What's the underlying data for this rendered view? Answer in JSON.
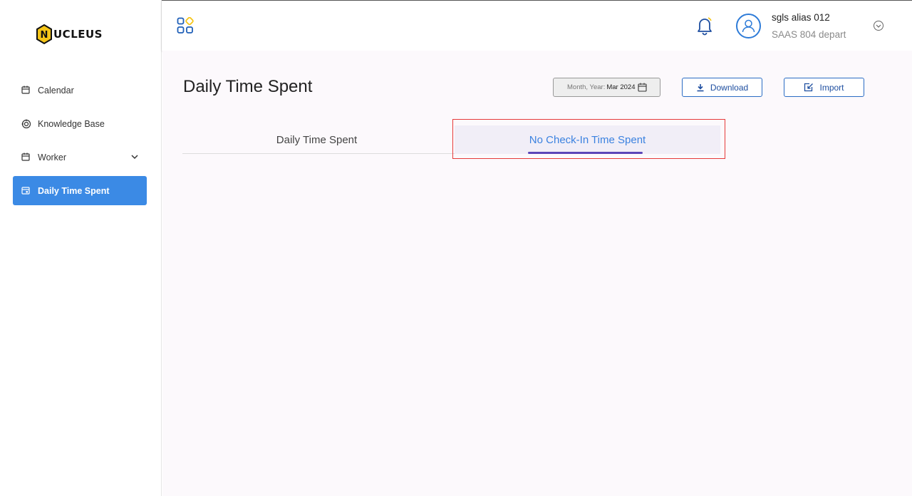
{
  "sidebar": {
    "logo_text": "UCLEUS",
    "logo_letter": "N",
    "items": [
      {
        "label": "Calendar",
        "icon": "calendar-icon"
      },
      {
        "label": "Knowledge Base",
        "icon": "knowledge-base-icon"
      },
      {
        "label": "Worker",
        "icon": "calendar-icon"
      },
      {
        "label": "Daily Time Spent",
        "icon": "calendar-icon"
      }
    ]
  },
  "header": {
    "user_name": "sgls alias 012",
    "user_dept": "SAAS 804 depart"
  },
  "main": {
    "title": "Daily Time Spent",
    "month_field": {
      "label": "Month, Year:",
      "value": "Mar 2024"
    },
    "download_label": "Download",
    "import_label": "Import",
    "tabs": [
      {
        "label": "Daily Time Spent"
      },
      {
        "label": "No Check-In Time Spent"
      }
    ]
  },
  "colors": {
    "accent": "#3b8ae5",
    "highlight": "#e63a3a",
    "tab_indicator": "#5b46b8"
  }
}
